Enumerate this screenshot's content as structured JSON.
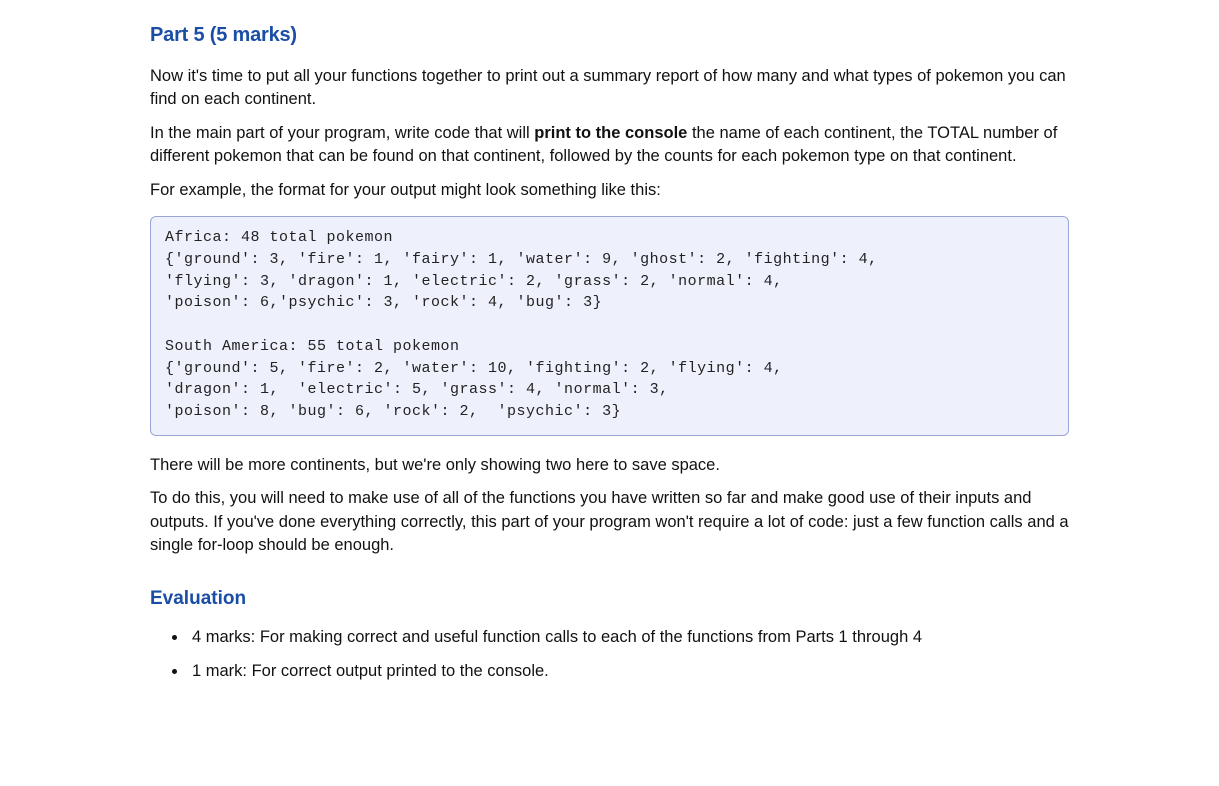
{
  "heading": "Part 5 (5 marks)",
  "para1": "Now it's time to put all your functions together to print out a summary report of how many and what types of pokemon you can find on each continent.",
  "para2_pre": "In the main part of your program, write code that will ",
  "para2_bold": "print to the console",
  "para2_post": " the name of each continent, the TOTAL number of different pokemon that can be found on that continent, followed by the counts for each pokemon type on that continent.",
  "para3": "For example, the format for your output might look something like this:",
  "code": "Africa: 48 total pokemon\n{'ground': 3, 'fire': 1, 'fairy': 1, 'water': 9, 'ghost': 2, 'fighting': 4,\n'flying': 3, 'dragon': 1, 'electric': 2, 'grass': 2, 'normal': 4,\n'poison': 6,'psychic': 3, 'rock': 4, 'bug': 3}\n\nSouth America: 55 total pokemon\n{'ground': 5, 'fire': 2, 'water': 10, 'fighting': 2, 'flying': 4,\n'dragon': 1,  'electric': 5, 'grass': 4, 'normal': 3,\n'poison': 8, 'bug': 6, 'rock': 2,  'psychic': 3}",
  "para4": "There will be more continents, but we're only showing two here to save space.",
  "para5": "To do this, you will need to make use of all of the functions you have written so far and make good use of their inputs and outputs. If you've done everything correctly, this part of your program won't require a lot of code: just a few function calls and a single for-loop should be enough.",
  "evaluation_heading": "Evaluation",
  "eval_items": [
    "4 marks: For making correct and useful function calls to each of the functions from Parts 1 through 4",
    "1 mark: For correct output printed to the console."
  ]
}
